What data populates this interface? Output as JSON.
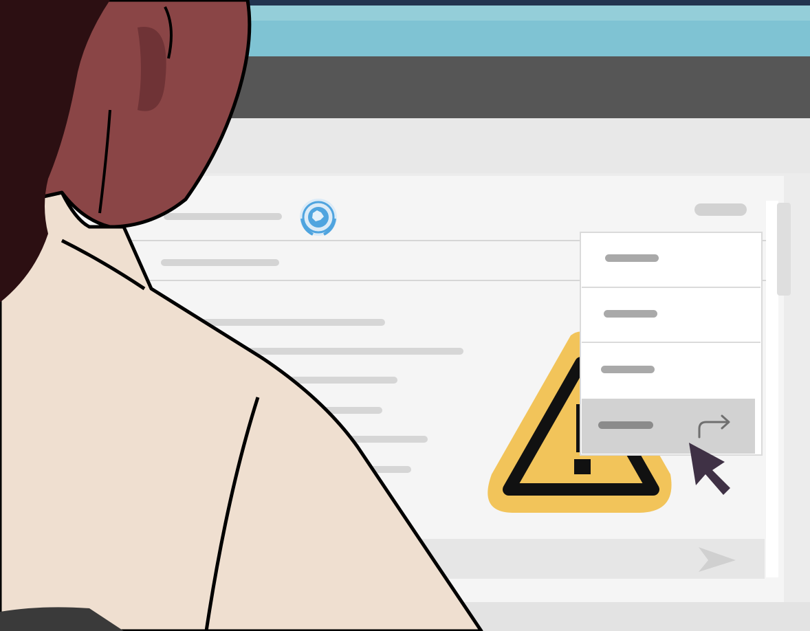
{
  "scene": {
    "description_type": "illustration",
    "colors": {
      "frame": "#22344f",
      "top_bar": "#7fc3d3",
      "toolbar": "#565656",
      "window_bg": "#ececec",
      "content_bg": "#f4f4f4",
      "warning_fill": "#f2c45a",
      "warning_outline": "#111111",
      "menu_highlight": "#d2d2d2",
      "cursor": "#3f3145",
      "skin": "#8a4546",
      "hair": "#2c0f12",
      "shirt": "#efdfd0",
      "un_emblem": "#4fa4df"
    }
  },
  "app": {
    "logo_icon": "un-emblem-icon",
    "context_menu": {
      "items": [
        {
          "state": "normal"
        },
        {
          "state": "normal"
        },
        {
          "state": "normal"
        },
        {
          "state": "highlighted",
          "icon": "forward-arrow-icon"
        }
      ]
    },
    "warning_icon": "warning-triangle-icon",
    "send_icon": "send-arrow-icon",
    "cursor_icon": "mouse-pointer-icon"
  }
}
